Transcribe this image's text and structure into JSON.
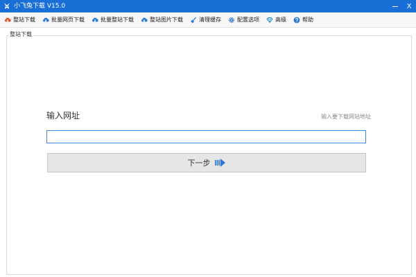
{
  "window": {
    "title": "小飞兔下载 V15.0",
    "close_glyph": "X"
  },
  "toolbar": {
    "items": [
      {
        "label": "整站下载",
        "icon": "cloud-download-icon",
        "color": "#e0522c"
      },
      {
        "label": "批量网页下载",
        "icon": "cloud-download-icon",
        "color": "#2a7ad5"
      },
      {
        "label": "批量整站下载",
        "icon": "cloud-download-icon",
        "color": "#2a7ad5"
      },
      {
        "label": "整站图片下载",
        "icon": "cloud-download-icon",
        "color": "#2a7ad5"
      },
      {
        "label": "清理缓存",
        "icon": "broom-icon",
        "color": "#2a7ad5"
      },
      {
        "label": "配置选项",
        "icon": "gear-icon",
        "color": "#2a7ad5"
      },
      {
        "label": "高级",
        "icon": "diamond-icon",
        "color": "#2a9ad5"
      },
      {
        "label": "帮助",
        "icon": "help-icon",
        "color": "#2a7ad5"
      }
    ]
  },
  "panel": {
    "group_title": "整站下载",
    "url_label": "输入网址",
    "url_hint": "输入要下载网站地址",
    "url_value": "",
    "next_label": "下一步"
  },
  "colors": {
    "accent": "#1a6fd6",
    "input_border": "#3b87d9"
  }
}
